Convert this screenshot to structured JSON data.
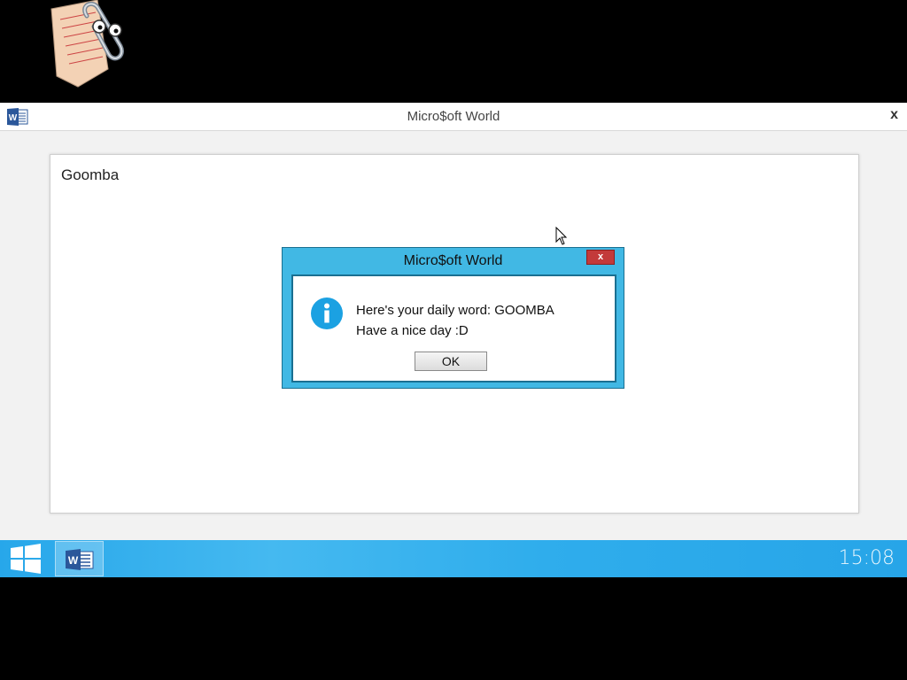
{
  "window": {
    "title": "Micro$oft World",
    "close_label": "x"
  },
  "document": {
    "text": "Goomba"
  },
  "dialog": {
    "title": "Micro$oft World",
    "close_label": "x",
    "line1": "Here's your daily word: GOOMBA",
    "line2": "Have a nice day :D",
    "ok_label": "OK",
    "icon": "info-icon"
  },
  "taskbar": {
    "clock": "15:08",
    "start_icon": "windows-logo-icon",
    "pinned_app_icon": "word-icon"
  },
  "colors": {
    "taskbar": "#2fadec",
    "dialog_frame": "#41b8e4",
    "dialog_close": "#c33a3a",
    "info_icon": "#1ba1e2"
  }
}
